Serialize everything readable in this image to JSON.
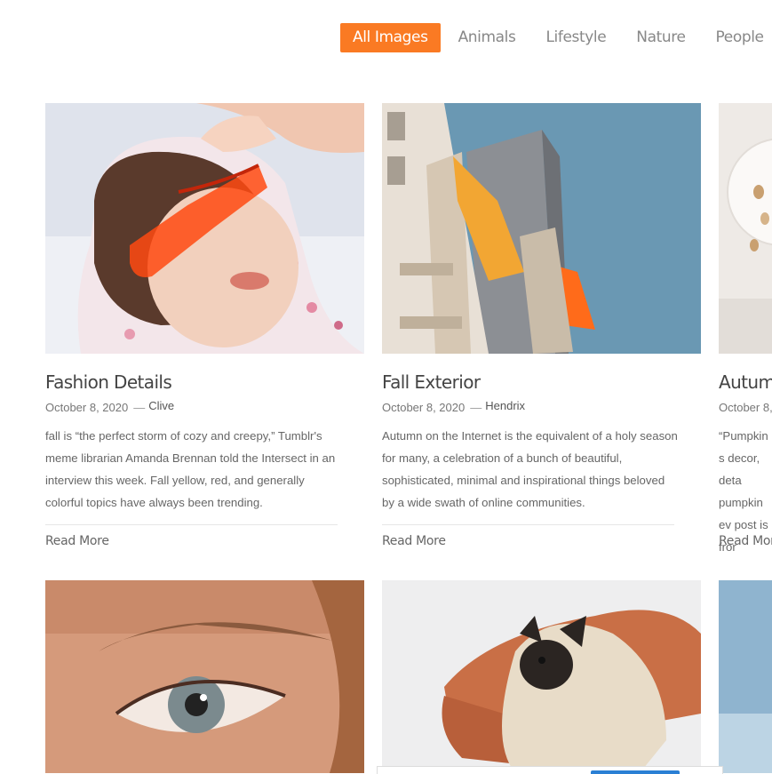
{
  "filters": [
    {
      "label": "All Images",
      "active": true
    },
    {
      "label": "Animals",
      "active": false
    },
    {
      "label": "Lifestyle",
      "active": false
    },
    {
      "label": "Nature",
      "active": false
    },
    {
      "label": "People",
      "active": false
    }
  ],
  "posts": [
    {
      "title": "Fashion Details",
      "date": "October 8, 2020",
      "author": "Clive",
      "excerpt": "fall is “the perfect storm of cozy and creepy,” Tumblr's meme librarian Amanda Brennan told the Intersect in an interview this week. Fall yellow, red, and generally colorful topics have always been trending.",
      "read_more": "Read More"
    },
    {
      "title": "Fall Exterior",
      "date": "October 8, 2020",
      "author": "Hendrix",
      "excerpt": "Autumn on the Internet is the equivalent of a holy season for many, a celebration of a bunch of beautiful, sophisticated, minimal and inspirational things beloved by a wide swath of online communities.",
      "read_more": "Read More"
    },
    {
      "title": "Autumn",
      "date": "October 8,",
      "excerpt": "“Pumpkin s decor, deta pumpkin ev post is fror",
      "read_more": "Read More"
    }
  ],
  "colors": {
    "accent": "#fa7a23"
  }
}
